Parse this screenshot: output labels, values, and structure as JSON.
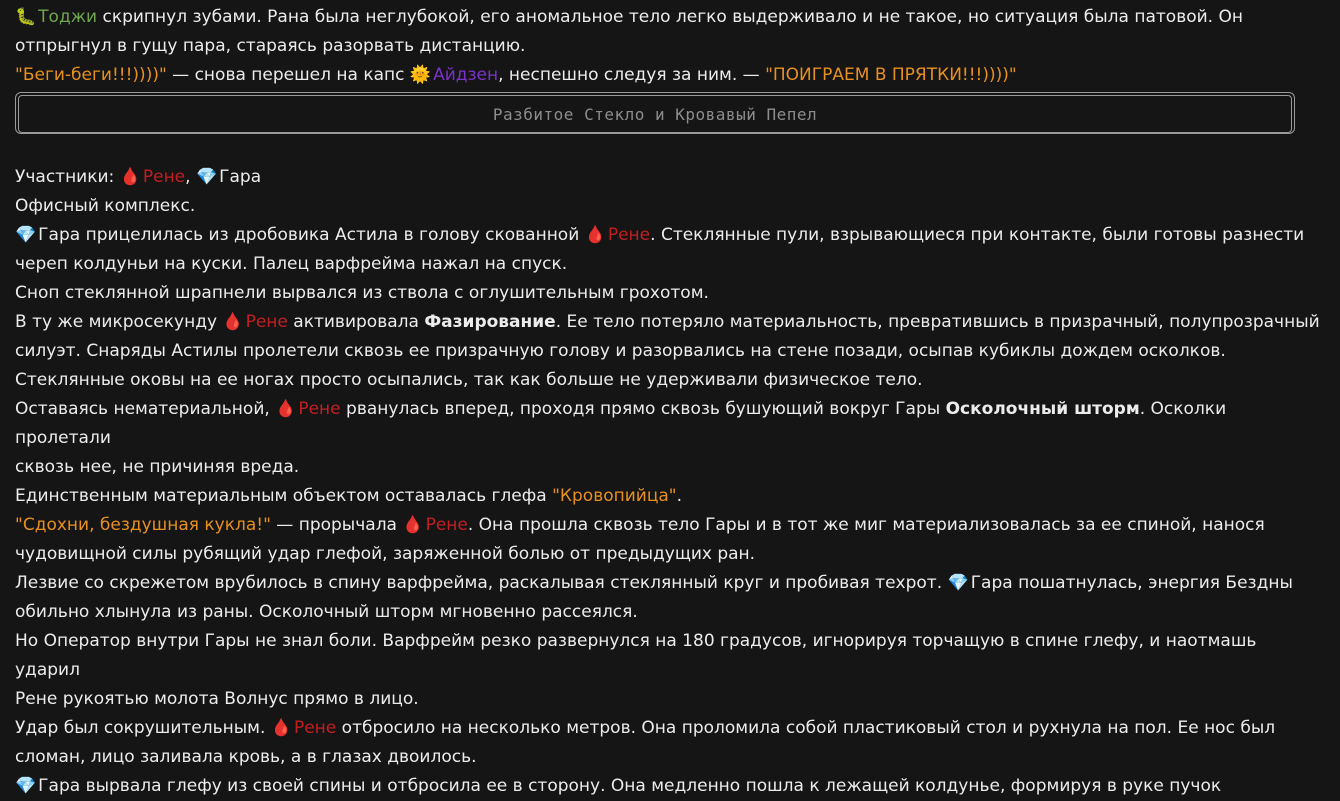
{
  "icons": {
    "toji": "🐛",
    "aiden": "🌞",
    "rene": "🩸",
    "gara": "💎"
  },
  "names": {
    "toji": "Тоджи",
    "aiden": "Айдзен",
    "rene": "Рене",
    "gara": "Гара"
  },
  "block1": {
    "l1_rest": " скрипнул зубами. Рана была неглубокой, его аномальное тело легко выдерживало и не такое, но ситуация была патовой. Он",
    "l2": "отпрыгнул в гущу пара, стараясь разорвать дистанцию.",
    "l3_quote1": "\"Беги-беги!!!))))\"",
    "l3_mid": " — снова перешел на капс ",
    "l3_after": ", неспешно следуя за ним. — ",
    "l3_quote2": "\"ПОИГРАЕМ В ПРЯТКИ!!!))))\""
  },
  "separator_title": "Разбитое Стекло и Кровавый Пепел",
  "block2": {
    "participants_label": "Участники: ",
    "comma": ", ",
    "location": "Офисный комплекс.",
    "p1a": " прицелилась из дробовика Астила в голову скованной ",
    "p1b": ". Стеклянные пули, взрывающиеся при контакте, были готовы разнести",
    "p1c": "череп колдуньи на куски. Палец варфрейма нажал на спуск.",
    "p2": "Сноп стеклянной шрапнели вырвался из ствола с оглушительным грохотом.",
    "p3a": "В ту же микросекунду ",
    "p3b": " активировала ",
    "p3_ability": "Фазирование",
    "p3c": ". Ее тело потеряло материальность, превратившись в призрачный, полупрозрачный",
    "p3d": "силуэт. Снаряды Астилы пролетели сквозь ее призрачную голову и разорвались на стене позади, осыпав кубиклы дождем осколков.",
    "p4": "Стеклянные оковы на ее ногах просто осыпались, так как больше не удерживали физическое тело.",
    "p5a": "Оставаясь нематериальной, ",
    "p5b": " рванулась вперед, проходя прямо сквозь бушующий вокруг Гары ",
    "p5_ability": "Осколочный шторм",
    "p5c": ". Осколки пролетали",
    "p5d": "сквозь нее, не причиняя вреда.",
    "p6a": "Единственным материальным объектом оставалась глефа ",
    "p6_quote": "\"Кровопийца\"",
    "p6b": ".",
    "p7_quote": "\"Сдохни, бездушная кукла!\"",
    "p7a": " — прорычала ",
    "p7b": ". Она прошла сквозь тело Гары и в тот же миг материализовалась за ее спиной, нанося",
    "p7c": "чудовищной силы рубящий удар глефой, заряженной болью от предыдущих ран.",
    "p8a": "Лезвие со скрежетом врубилось в спину варфрейма, раскалывая стеклянный круг и пробивая техрот. ",
    "p8b": " пошатнулась, энергия Бездны",
    "p8c": "обильно хлынула из раны. Осколочный шторм мгновенно рассеялся.",
    "p9a": "Но Оператор внутри Гары не знал боли. Варфрейм резко развернулся на 180 градусов, игнорируя торчащую в спине глефу, и наотмашь ударил",
    "p9b": "Рене рукоятью молота Волнус прямо в лицо.",
    "p10a": "Удар был сокрушительным. ",
    "p10b": " отбросило на несколько метров. Она проломила собой пластиковый стол и рухнула на пол. Ее нос был",
    "p10c": "сломан, лицо заливала кровь, а в глазах двоилось.",
    "p11": " вырвала глефу из своей спины и отбросила ее в сторону. Она медленно пошла к лежащей колдунье, формируя в руке пучок"
  }
}
